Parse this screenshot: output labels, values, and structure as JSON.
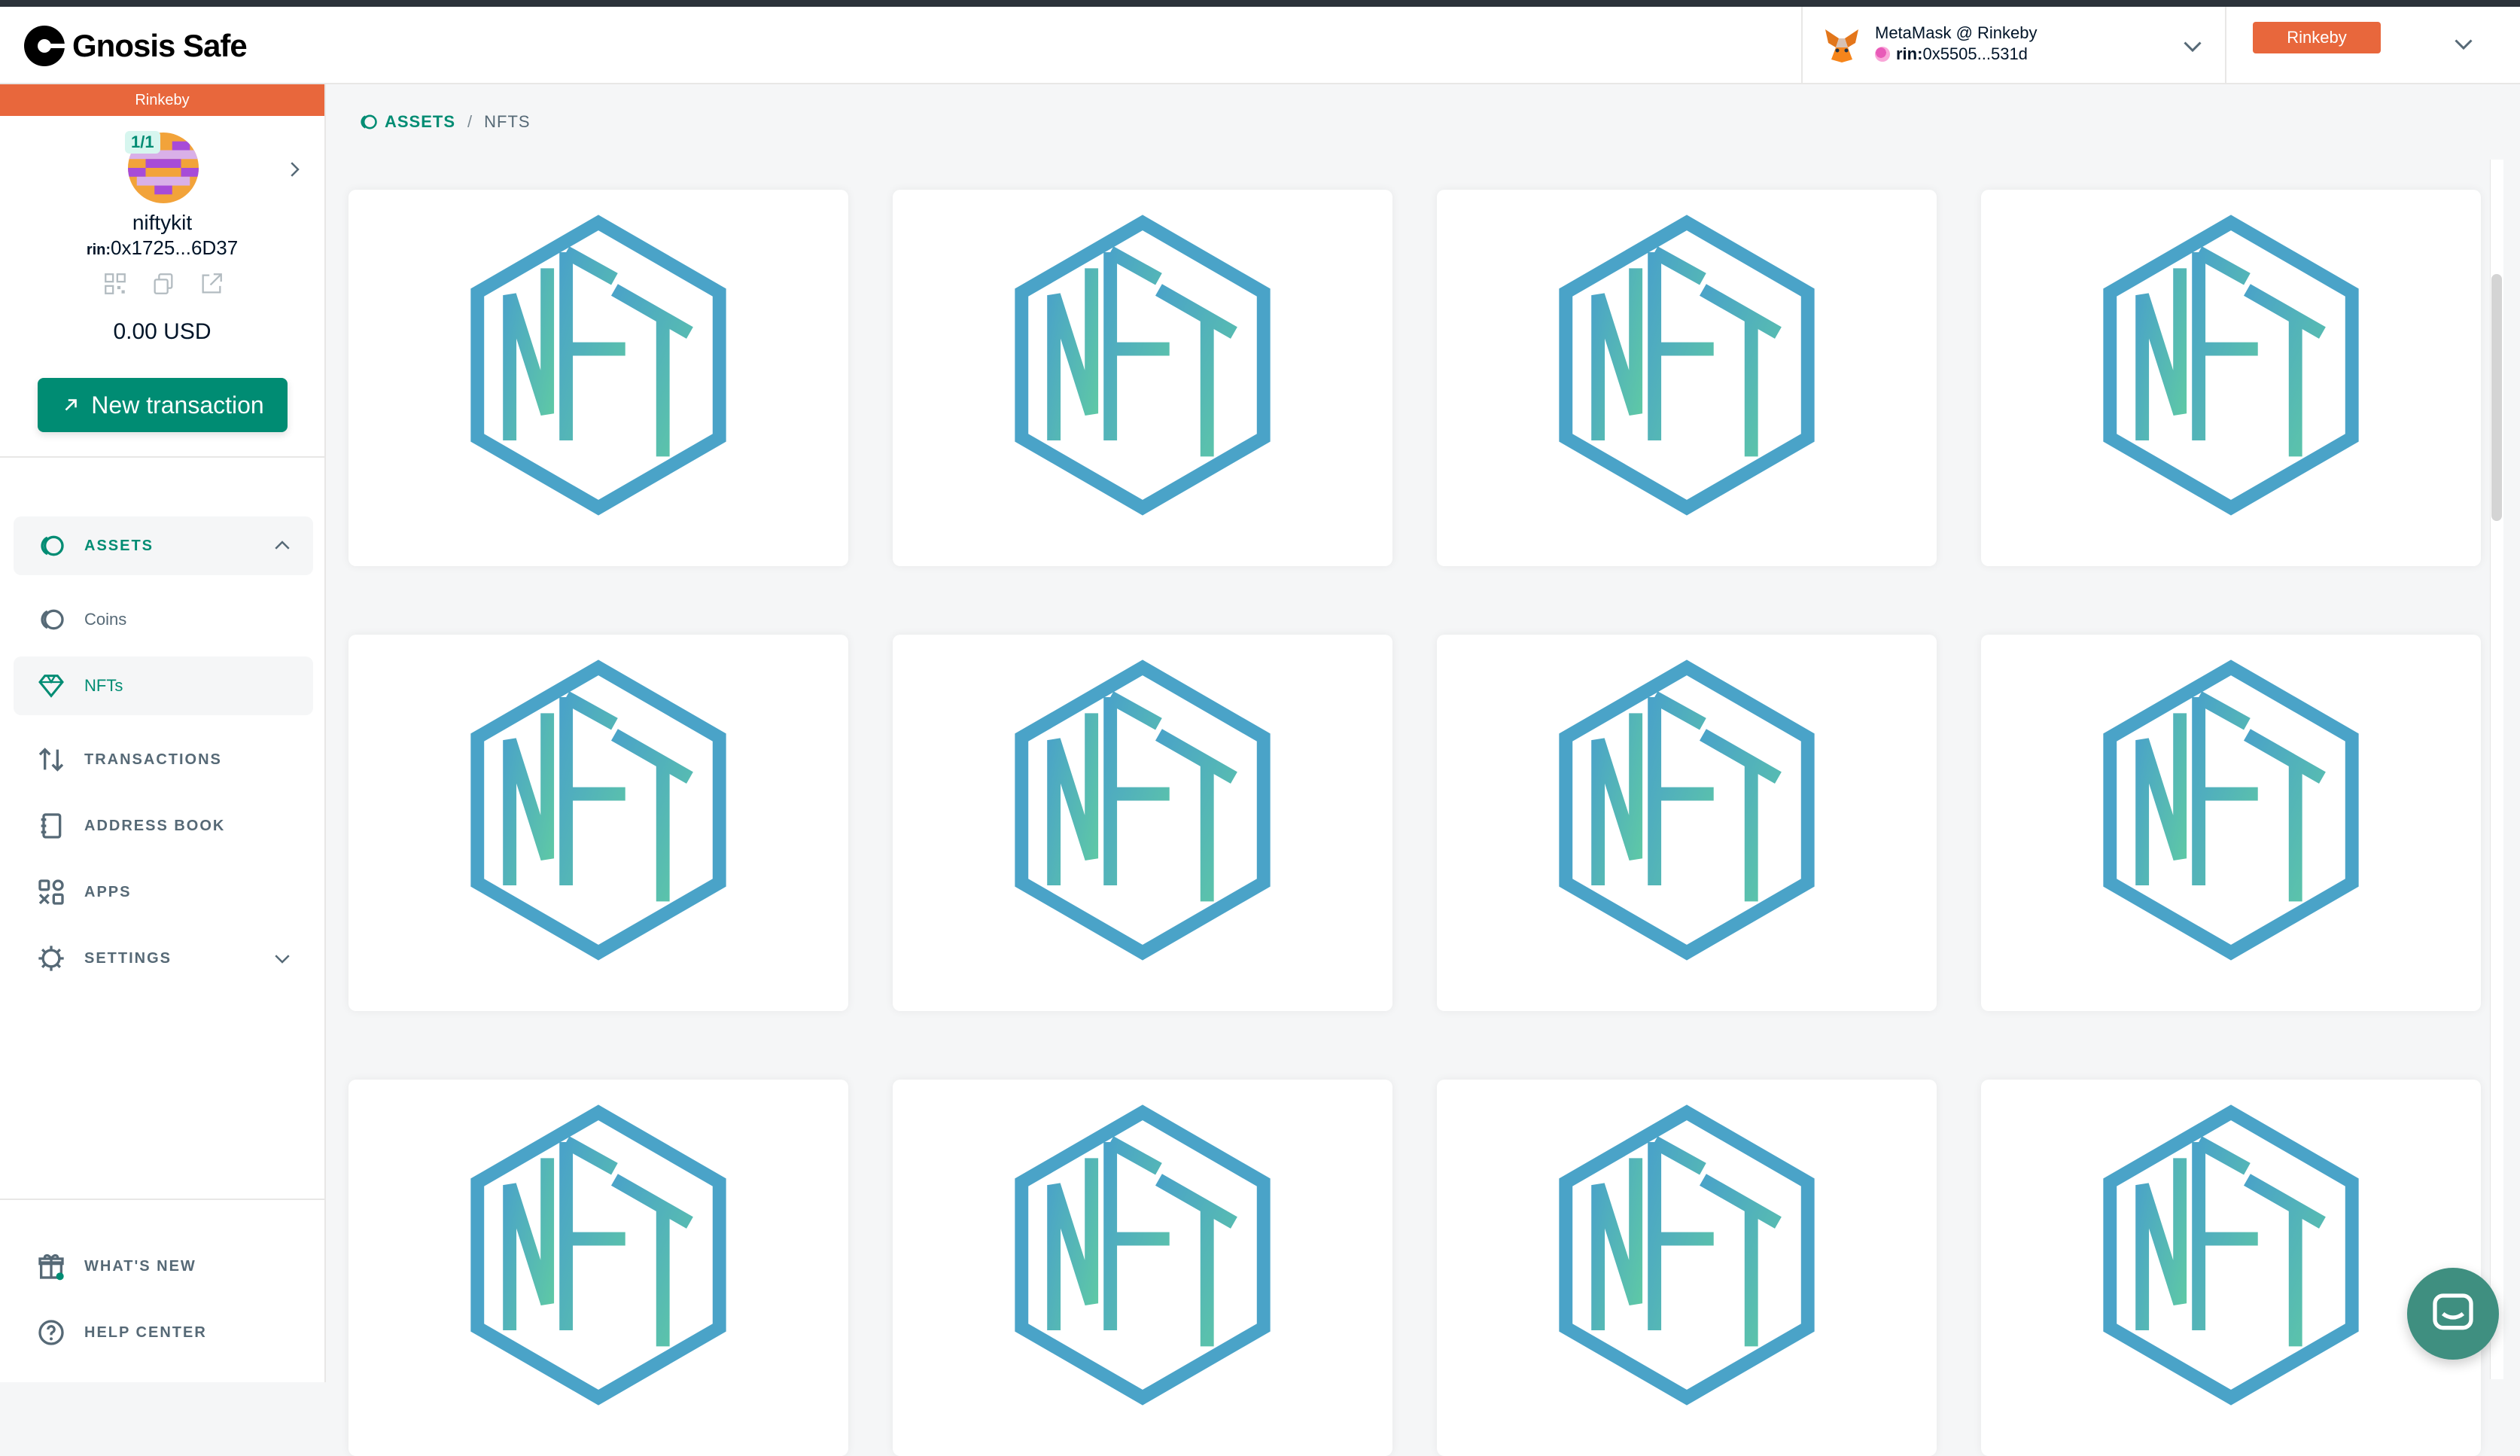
{
  "header": {
    "brand": "Gnosis Safe",
    "wallet": {
      "title": "MetaMask @ Rinkeby",
      "prefix": "rin:",
      "address": "0x5505...531d"
    },
    "network": "Rinkeby"
  },
  "sidebar": {
    "network_banner": "Rinkeby",
    "threshold": "1/1",
    "safe_name": "niftykit",
    "safe_prefix": "rin:",
    "safe_address": "0x1725...6D37",
    "balance": "0.00 USD",
    "new_transaction": "New transaction",
    "nav": {
      "assets": "ASSETS",
      "coins": "Coins",
      "nfts": "NFTs",
      "transactions": "TRANSACTIONS",
      "address_book": "ADDRESS BOOK",
      "apps": "APPS",
      "settings": "SETTINGS",
      "whats_new": "WHAT'S NEW",
      "help_center": "HELP CENTER"
    }
  },
  "breadcrumb": {
    "assets": "ASSETS",
    "separator": "/",
    "current": "NFTS"
  },
  "nft_cards": [
    {
      "icon": "nft-icon"
    },
    {
      "icon": "nft-icon"
    },
    {
      "icon": "nft-icon"
    },
    {
      "icon": "nft-icon"
    },
    {
      "icon": "nft-icon"
    },
    {
      "icon": "nft-icon"
    },
    {
      "icon": "nft-icon"
    },
    {
      "icon": "nft-icon"
    },
    {
      "icon": "nft-icon"
    },
    {
      "icon": "nft-icon"
    },
    {
      "icon": "nft-icon"
    },
    {
      "icon": "nft-icon"
    }
  ],
  "colors": {
    "accent": "#008c73",
    "network": "#e8673c",
    "nft_blue": "#4aa3c8",
    "nft_green": "#5ec8a6"
  }
}
